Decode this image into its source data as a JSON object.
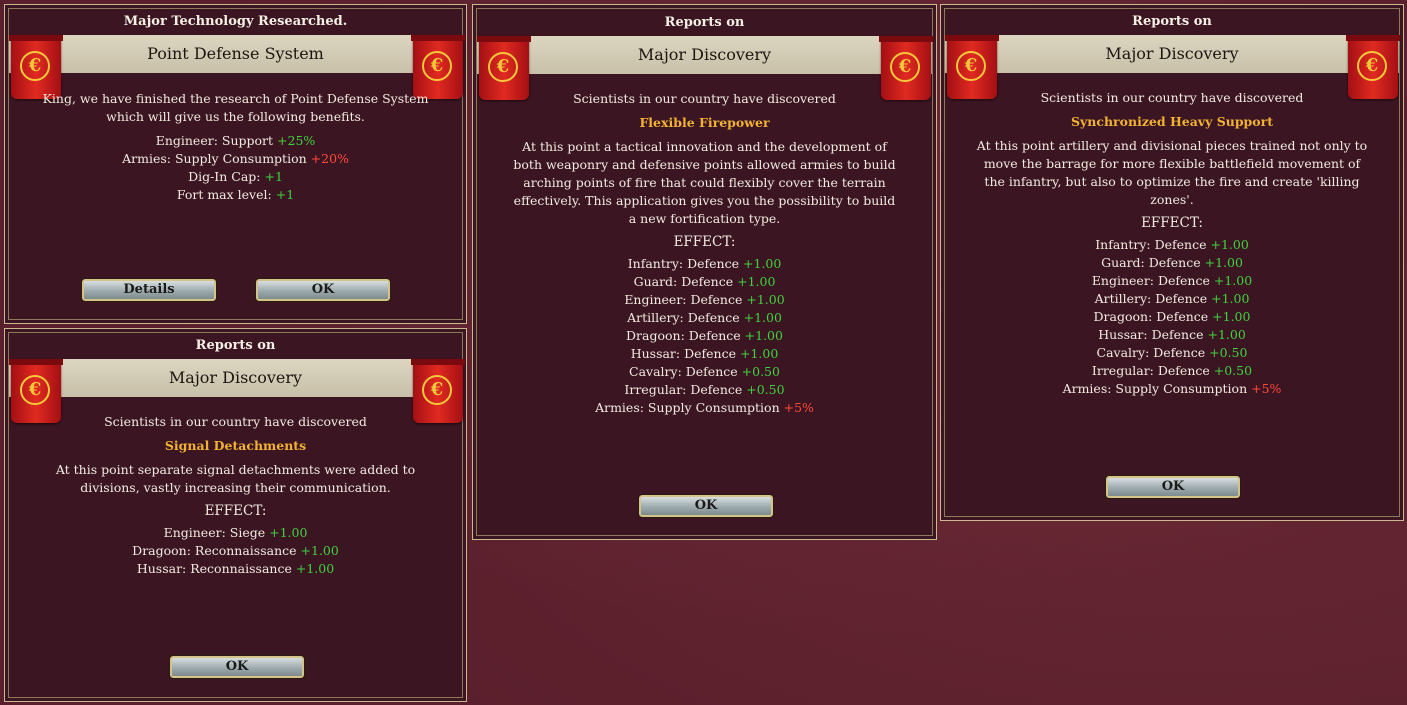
{
  "panels": {
    "tech": {
      "title": "Major Technology Researched.",
      "subtitle": "Point Defense System",
      "intro": [
        "King, we have finished the research of Point Defense System",
        "which will give us the following benefits."
      ],
      "effects": [
        {
          "label": "Engineer: Support",
          "value": "+25%",
          "tone": "pos"
        },
        {
          "label": "Armies: Supply Consumption",
          "value": "+20%",
          "tone": "neg"
        },
        {
          "label": "Dig-In Cap:",
          "value": "+1",
          "tone": "pos"
        },
        {
          "label": "Fort max level:",
          "value": "+1",
          "tone": "pos"
        }
      ],
      "details_label": "Details",
      "ok_label": "OK"
    },
    "signal": {
      "title": "Reports on",
      "subtitle": "Major Discovery",
      "intro": "Scientists in our country have discovered",
      "discovery": "Signal Detachments",
      "desc": [
        "At this point separate signal detachments were added to",
        "divisions, vastly increasing their communication."
      ],
      "effect_header": "EFFECT:",
      "effects": [
        {
          "label": "Engineer: Siege",
          "value": "+1.00",
          "tone": "pos"
        },
        {
          "label": "Dragoon: Reconnaissance",
          "value": "+1.00",
          "tone": "pos"
        },
        {
          "label": "Hussar: Reconnaissance",
          "value": "+1.00",
          "tone": "pos"
        }
      ],
      "ok_label": "OK"
    },
    "firepower": {
      "title": "Reports on",
      "subtitle": "Major Discovery",
      "intro": "Scientists in our country have discovered",
      "discovery": "Flexible Firepower",
      "desc": [
        "At this point a tactical innovation and the development of",
        "both weaponry and defensive points allowed armies to build",
        "arching points of fire that could flexibly cover the terrain",
        "effectively. This application gives you the possibility to build",
        "a new fortification type."
      ],
      "effect_header": "EFFECT:",
      "effects": [
        {
          "label": "Infantry: Defence",
          "value": "+1.00",
          "tone": "pos"
        },
        {
          "label": "Guard: Defence",
          "value": "+1.00",
          "tone": "pos"
        },
        {
          "label": "Engineer: Defence",
          "value": "+1.00",
          "tone": "pos"
        },
        {
          "label": "Artillery: Defence",
          "value": "+1.00",
          "tone": "pos"
        },
        {
          "label": "Dragoon: Defence",
          "value": "+1.00",
          "tone": "pos"
        },
        {
          "label": "Hussar: Defence",
          "value": "+1.00",
          "tone": "pos"
        },
        {
          "label": "Cavalry: Defence",
          "value": "+0.50",
          "tone": "pos"
        },
        {
          "label": "Irregular: Defence",
          "value": "+0.50",
          "tone": "pos"
        },
        {
          "label": "Armies: Supply Consumption",
          "value": "+5%",
          "tone": "neg"
        }
      ],
      "ok_label": "OK"
    },
    "heavy": {
      "title": "Reports on",
      "subtitle": "Major Discovery",
      "intro": "Scientists in our country have discovered",
      "discovery": "Synchronized Heavy Support",
      "desc": [
        "At this point artillery and divisional pieces trained not only to",
        "move the barrage for more flexible battlefield movement of",
        "the infantry, but also to optimize the fire and create 'killing",
        "zones'."
      ],
      "effect_header": "EFFECT:",
      "effects": [
        {
          "label": "Infantry: Defence",
          "value": "+1.00",
          "tone": "pos"
        },
        {
          "label": "Guard: Defence",
          "value": "+1.00",
          "tone": "pos"
        },
        {
          "label": "Engineer: Defence",
          "value": "+1.00",
          "tone": "pos"
        },
        {
          "label": "Artillery: Defence",
          "value": "+1.00",
          "tone": "pos"
        },
        {
          "label": "Dragoon: Defence",
          "value": "+1.00",
          "tone": "pos"
        },
        {
          "label": "Hussar: Defence",
          "value": "+1.00",
          "tone": "pos"
        },
        {
          "label": "Cavalry: Defence",
          "value": "+0.50",
          "tone": "pos"
        },
        {
          "label": "Irregular: Defence",
          "value": "+0.50",
          "tone": "pos"
        },
        {
          "label": "Armies: Supply Consumption",
          "value": "+5%",
          "tone": "neg"
        }
      ],
      "ok_label": "OK"
    }
  },
  "colors": {
    "highlight": "#f2b233",
    "positive": "#3fd23f",
    "negative": "#ff4a3a"
  }
}
